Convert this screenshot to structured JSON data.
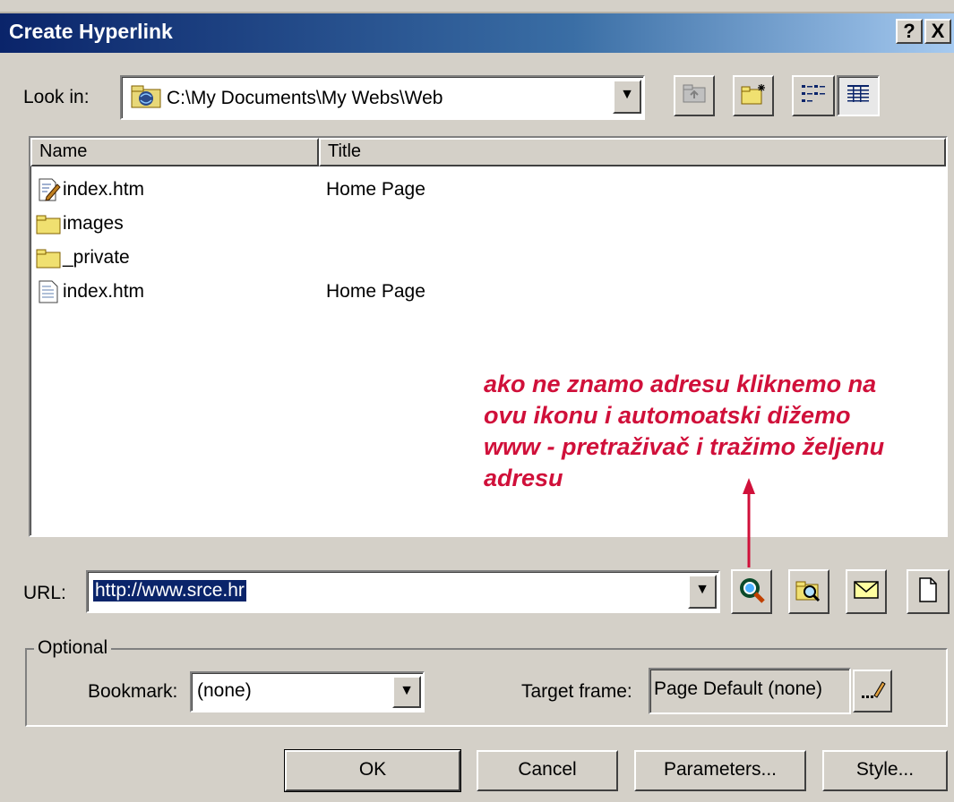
{
  "window": {
    "title": "Create Hyperlink",
    "help_btn": "?",
    "close_btn": "X"
  },
  "look_in": {
    "label": "Look in:",
    "path": "C:\\My Documents\\My Webs\\Web",
    "icons": [
      "web-folder-icon",
      "up-one-level-icon",
      "new-folder-icon",
      "list-view-icon",
      "details-view-icon"
    ]
  },
  "file_list": {
    "columns": [
      "Name",
      "Title"
    ],
    "rows": [
      {
        "name": "index.htm",
        "title": "Home Page",
        "icon": "edited-page-icon"
      },
      {
        "name": "images",
        "title": "",
        "icon": "folder-icon"
      },
      {
        "name": "_private",
        "title": "",
        "icon": "folder-icon"
      },
      {
        "name": "index.htm",
        "title": "Home Page",
        "icon": "page-icon"
      }
    ]
  },
  "annotation": {
    "lines": [
      "ako ne znamo adresu kliknemo na",
      "ovu ikonu i automoatski dižemo",
      "www - pretraživač i tražimo željenu",
      "adresu"
    ],
    "color": "#d0103a"
  },
  "url": {
    "label": "URL:",
    "value": "http://www.srce.hr",
    "icons": [
      "web-browse-icon",
      "file-browse-icon",
      "email-icon",
      "new-page-icon"
    ]
  },
  "optional": {
    "label": "Optional",
    "bookmark_label": "Bookmark:",
    "bookmark_value": "(none)",
    "target_label": "Target frame:",
    "target_value": "Page Default (none)"
  },
  "buttons": {
    "ok": "OK",
    "cancel": "Cancel",
    "parameters": "Parameters...",
    "style": "Style..."
  },
  "colors": {
    "title_bar": "#0a246a",
    "face": "#d4d0c8",
    "annotation": "#d0103a"
  }
}
